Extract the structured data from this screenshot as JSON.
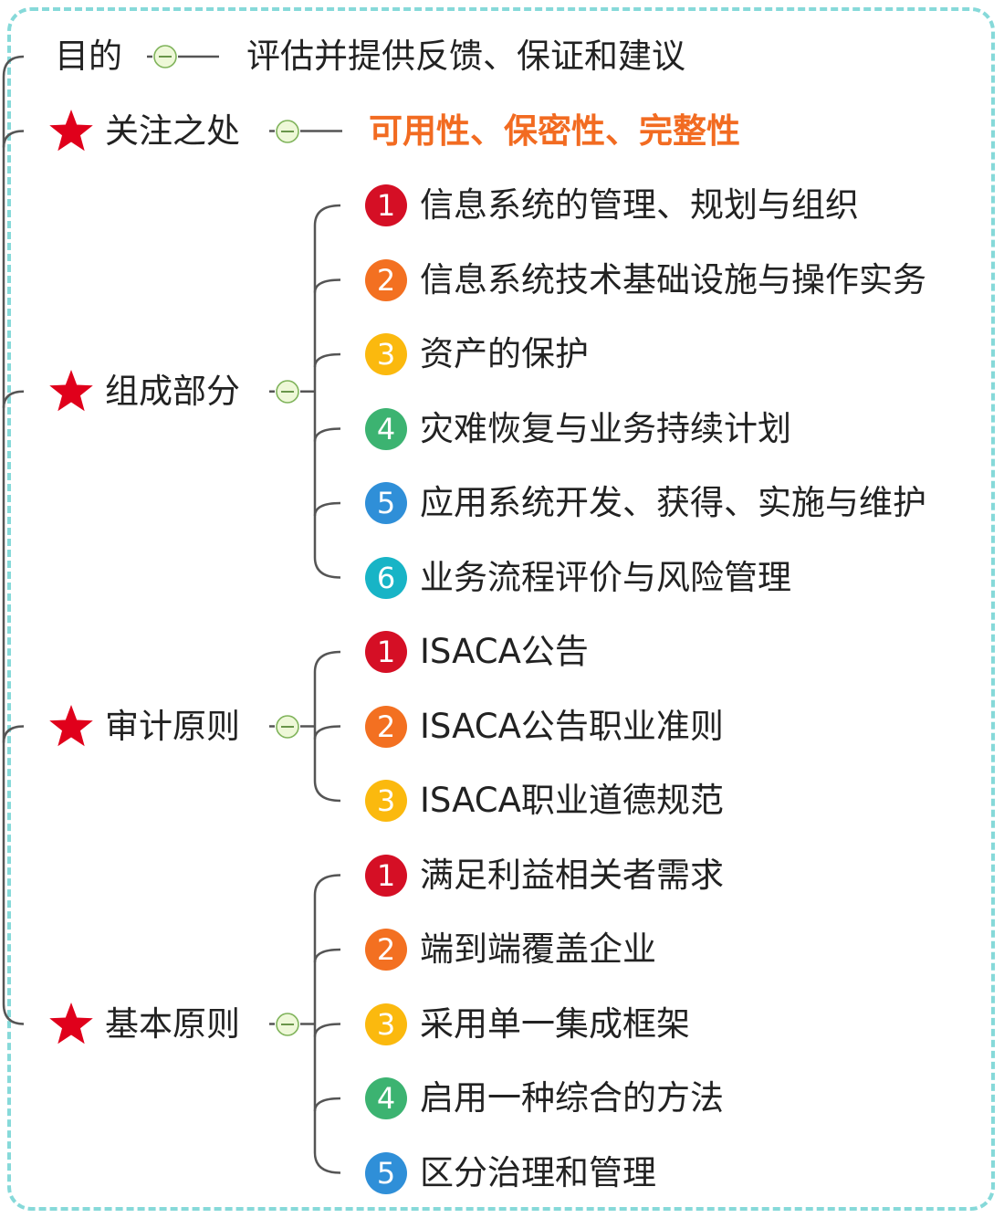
{
  "colors": {
    "frame": "#86d9d9",
    "line": "#555555",
    "star": "#e0001b",
    "highlight": "#f26b21",
    "badge": [
      "#d50f25",
      "#f37021",
      "#fbb90e",
      "#3cb371",
      "#2f8fd8",
      "#18b4c6"
    ]
  },
  "topics": [
    {
      "id": "purpose",
      "label": "目的",
      "star": false,
      "children": [
        {
          "text": "评估并提供反馈、保证和建议",
          "highlight": false
        }
      ]
    },
    {
      "id": "focus",
      "label": "关注之处",
      "star": true,
      "children": [
        {
          "text": "可用性、保密性、完整性",
          "highlight": true
        }
      ]
    },
    {
      "id": "components",
      "label": "组成部分",
      "star": true,
      "children": [
        {
          "num": "1",
          "text": "信息系统的管理、规划与组织"
        },
        {
          "num": "2",
          "text": "信息系统技术基础设施与操作实务"
        },
        {
          "num": "3",
          "text": "资产的保护"
        },
        {
          "num": "4",
          "text": "灾难恢复与业务持续计划"
        },
        {
          "num": "5",
          "text": "应用系统开发、获得、实施与维护"
        },
        {
          "num": "6",
          "text": "业务流程评价与风险管理"
        }
      ]
    },
    {
      "id": "audit-principles",
      "label": "审计原则",
      "star": true,
      "children": [
        {
          "num": "1",
          "text": "ISACA公告"
        },
        {
          "num": "2",
          "text": "ISACA公告职业准则"
        },
        {
          "num": "3",
          "text": "ISACA职业道德规范"
        }
      ]
    },
    {
      "id": "basic-principles",
      "label": "基本原则",
      "star": true,
      "children": [
        {
          "num": "1",
          "text": "满足利益相关者需求"
        },
        {
          "num": "2",
          "text": "端到端覆盖企业"
        },
        {
          "num": "3",
          "text": "采用单一集成框架"
        },
        {
          "num": "4",
          "text": "启用一种综合的方法"
        },
        {
          "num": "5",
          "text": "区分治理和管理"
        }
      ]
    }
  ]
}
